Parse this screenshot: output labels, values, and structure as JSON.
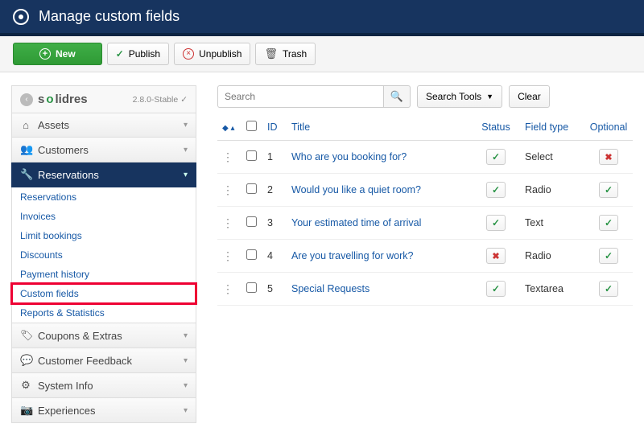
{
  "header": {
    "title": "Manage custom fields"
  },
  "toolbar": {
    "new": "New",
    "publish": "Publish",
    "unpublish": "Unpublish",
    "trash": "Trash"
  },
  "sidebar": {
    "brand": "solidres",
    "version": "2.8.0-Stable",
    "sections": [
      {
        "icon": "home",
        "label": "Assets"
      },
      {
        "icon": "users",
        "label": "Customers"
      },
      {
        "icon": "key",
        "label": "Reservations",
        "active": true,
        "items": [
          {
            "label": "Reservations"
          },
          {
            "label": "Invoices"
          },
          {
            "label": "Limit bookings"
          },
          {
            "label": "Discounts"
          },
          {
            "label": "Payment history"
          },
          {
            "label": "Custom fields",
            "highlight": true
          },
          {
            "label": "Reports & Statistics"
          }
        ]
      },
      {
        "icon": "tag",
        "label": "Coupons & Extras"
      },
      {
        "icon": "comment",
        "label": "Customer Feedback"
      },
      {
        "icon": "gear",
        "label": "System Info"
      },
      {
        "icon": "camera",
        "label": "Experiences"
      }
    ]
  },
  "search": {
    "placeholder": "Search",
    "tools": "Search Tools",
    "clear": "Clear"
  },
  "table": {
    "columns": {
      "id": "ID",
      "title": "Title",
      "status": "Status",
      "fieldtype": "Field type",
      "optional": "Optional"
    },
    "rows": [
      {
        "id": 1,
        "title": "Who are you booking for?",
        "status": true,
        "fieldtype": "Select",
        "optional": false
      },
      {
        "id": 2,
        "title": "Would you like a quiet room?",
        "status": true,
        "fieldtype": "Radio",
        "optional": true
      },
      {
        "id": 3,
        "title": "Your estimated time of arrival",
        "status": true,
        "fieldtype": "Text",
        "optional": true
      },
      {
        "id": 4,
        "title": "Are you travelling for work?",
        "status": false,
        "fieldtype": "Radio",
        "optional": true
      },
      {
        "id": 5,
        "title": "Special Requests",
        "status": true,
        "fieldtype": "Textarea",
        "optional": true
      }
    ]
  }
}
